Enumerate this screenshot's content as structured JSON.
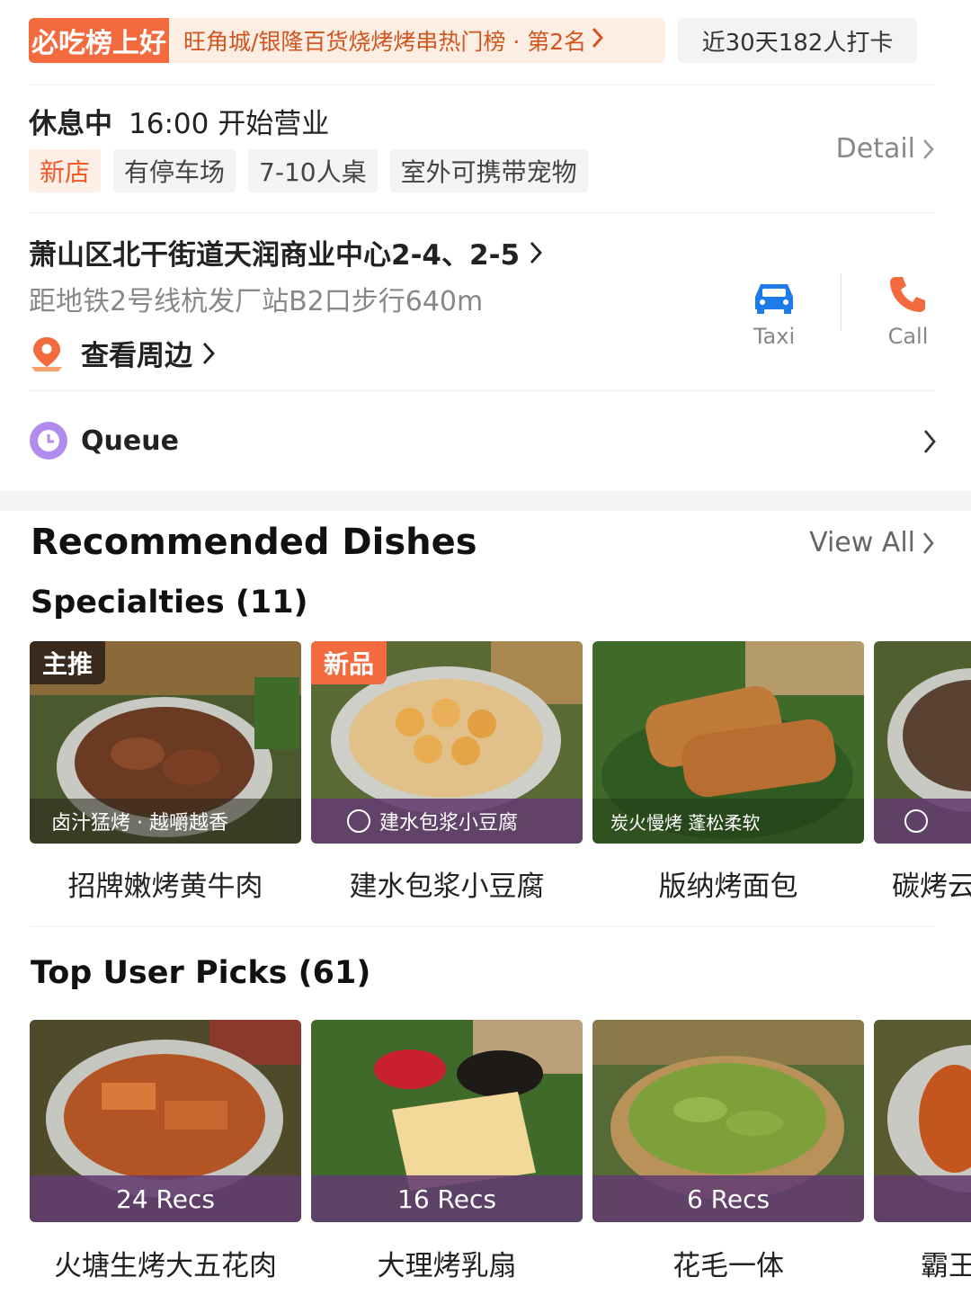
{
  "ranking": {
    "logo_text": "必吃榜上好",
    "text": "旺角城/银隆百货烧烤烤串热门榜 · 第2名",
    "checkins": "近30天182人打卡"
  },
  "hours": {
    "status": "休息中",
    "open_time": "16:00 开始营业",
    "detail_label": "Detail"
  },
  "tags": [
    "新店",
    "有停车场",
    "7-10人桌",
    "室外可携带宠物"
  ],
  "location": {
    "address": "萧山区北干街道天润商业中心2-4、2-5",
    "subway": "距地铁2号线杭发厂站B2口步行640m",
    "nearby_label": "查看周边",
    "taxi_label": "Taxi",
    "call_label": "Call"
  },
  "queue": {
    "label": "Queue"
  },
  "recommended": {
    "title": "Recommended Dishes",
    "view_all": "View All",
    "specialties": {
      "title": "Specialties (11)",
      "items": [
        {
          "name": "招牌嫩烤黄牛肉",
          "badge": "主推",
          "band": "卤汁猛烤 · 越嚼越香"
        },
        {
          "name": "建水包浆小豆腐",
          "badge": "新品",
          "band": "建水包浆小豆腐"
        },
        {
          "name": "版纳烤面包",
          "badge": "",
          "band": "炭火慢烤 蓬松柔软"
        },
        {
          "name": "碳烤云",
          "badge": "",
          "band": ""
        }
      ]
    },
    "top_picks": {
      "title": "Top User Picks (61)",
      "items": [
        {
          "name": "火塘生烤大五花肉",
          "recs": "24 Recs"
        },
        {
          "name": "大理烤乳扇",
          "recs": "16 Recs"
        },
        {
          "name": "花毛一体",
          "recs": "6 Recs"
        },
        {
          "name": "霸王",
          "recs": ""
        }
      ]
    }
  },
  "colors": {
    "accent": "#f05a28",
    "band": "#623c70",
    "taxi": "#1e7be8",
    "queue": "#b28bef"
  }
}
